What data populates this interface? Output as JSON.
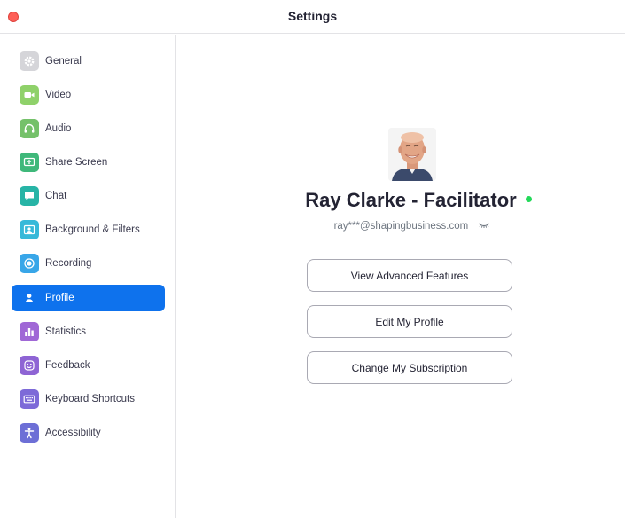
{
  "window": {
    "title": "Settings"
  },
  "sidebar": {
    "items": [
      {
        "label": "General",
        "icon": "gear-icon",
        "color": "#d5d5d9",
        "active": false
      },
      {
        "label": "Video",
        "icon": "video-camera-icon",
        "color": "#8fd16a",
        "active": false
      },
      {
        "label": "Audio",
        "icon": "headphones-icon",
        "color": "#75c16a",
        "active": false
      },
      {
        "label": "Share Screen",
        "icon": "share-screen-icon",
        "color": "#3fb87a",
        "active": false
      },
      {
        "label": "Chat",
        "icon": "chat-bubble-icon",
        "color": "#27b4a6",
        "active": false
      },
      {
        "label": "Background & Filters",
        "icon": "background-icon",
        "color": "#37b9d9",
        "active": false
      },
      {
        "label": "Recording",
        "icon": "record-icon",
        "color": "#38a6e8",
        "active": false
      },
      {
        "label": "Profile",
        "icon": "person-icon",
        "color": "#0e72ed",
        "active": true
      },
      {
        "label": "Statistics",
        "icon": "bar-chart-icon",
        "color": "#a068d6",
        "active": false
      },
      {
        "label": "Feedback",
        "icon": "smiley-icon",
        "color": "#8e64d4",
        "active": false
      },
      {
        "label": "Keyboard Shortcuts",
        "icon": "keyboard-icon",
        "color": "#7d6ad8",
        "active": false
      },
      {
        "label": "Accessibility",
        "icon": "accessibility-icon",
        "color": "#6d6fd6",
        "active": false
      }
    ]
  },
  "profile": {
    "name": "Ray Clarke - Facilitator",
    "email": "ray***@shapingbusiness.com",
    "status_color": "#23d959",
    "buttons": {
      "advanced": "View Advanced Features",
      "edit": "Edit My Profile",
      "subscription": "Change My Subscription"
    }
  }
}
